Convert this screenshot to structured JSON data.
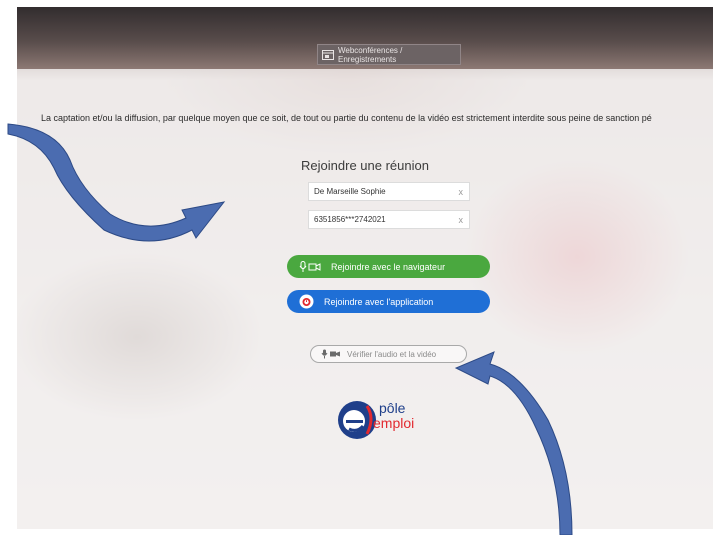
{
  "header": {
    "nav_tab_label": "Webconférences / Enregistrements"
  },
  "notice": {
    "text": "La captation et/ou la diffusion, par quelque moyen que ce soit, de tout ou partie du contenu de la vidéo est strictement interdite sous peine de sanction pé"
  },
  "join": {
    "title": "Rejoindre une réunion",
    "name_field_value": "De Marseille Sophie",
    "meeting_field_value": "6351856***2742021",
    "clear_glyph": "x",
    "browser_button_label": "Rejoindre avec le navigateur",
    "app_button_label": "Rejoindre avec l'application",
    "verify_button_label": "Vérifier l'audio et la vidéo"
  },
  "logo": {
    "line1": "pôle",
    "line2": "emploi"
  },
  "colors": {
    "green_button": "#4aa83f",
    "blue_button": "#1f6fd6",
    "arrow": "#4b6cb0",
    "logo_blue": "#1f3f8a",
    "logo_red": "#e2292f"
  },
  "icons": {
    "nav_tab": "calendar-video-icon",
    "browser_button": "mic-camera-icon",
    "app_button": "app-alarm-icon",
    "verify_button": "mic-camera-icon",
    "annotation_arrows": "curved-arrow"
  }
}
